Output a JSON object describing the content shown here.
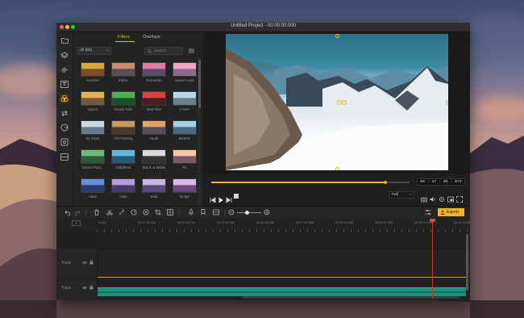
{
  "window": {
    "title": "Untitled Project - 00:00:00.000"
  },
  "library": {
    "tabs": [
      {
        "label": "Filters"
      },
      {
        "label": "Overlays"
      }
    ],
    "category_select": "All (64)",
    "search_placeholder": "Search",
    "filters": [
      {
        "label": "Autumn"
      },
      {
        "label": "Retro"
      },
      {
        "label": "Romantic"
      },
      {
        "label": "Sweet Love"
      },
      {
        "label": "Warm"
      },
      {
        "label": "Green Film"
      },
      {
        "label": "Red Film"
      },
      {
        "label": "Fresh"
      },
      {
        "label": "SL Style"
      },
      {
        "label": "Oil Painting"
      },
      {
        "label": "Youth"
      },
      {
        "label": "Breeze"
      },
      {
        "label": "Green Pant..."
      },
      {
        "label": "Maldives"
      },
      {
        "label": "Black & White"
      },
      {
        "label": "Fit"
      },
      {
        "label": "Atlas"
      },
      {
        "label": "Halo"
      },
      {
        "label": "Mist"
      },
      {
        "label": "Bulge"
      }
    ]
  },
  "playback": {
    "timecode": "00 : 37 : 05 . 872",
    "zoom": "Full",
    "progress": 0.88
  },
  "toolbar": {
    "export_label": "Export"
  },
  "timeline": {
    "ruler": [
      "0.000",
      "00:17:30.000",
      "00:20:00.000",
      "00:22:30.000",
      "00:25:00.000",
      "00:27:30.000",
      "00:30:00.000",
      "00:32:30.000",
      "00:35:00.000",
      "00:37:30.000"
    ],
    "tracks": [
      {
        "label": "Track"
      },
      {
        "label": "Track"
      }
    ],
    "track_number": "1"
  }
}
